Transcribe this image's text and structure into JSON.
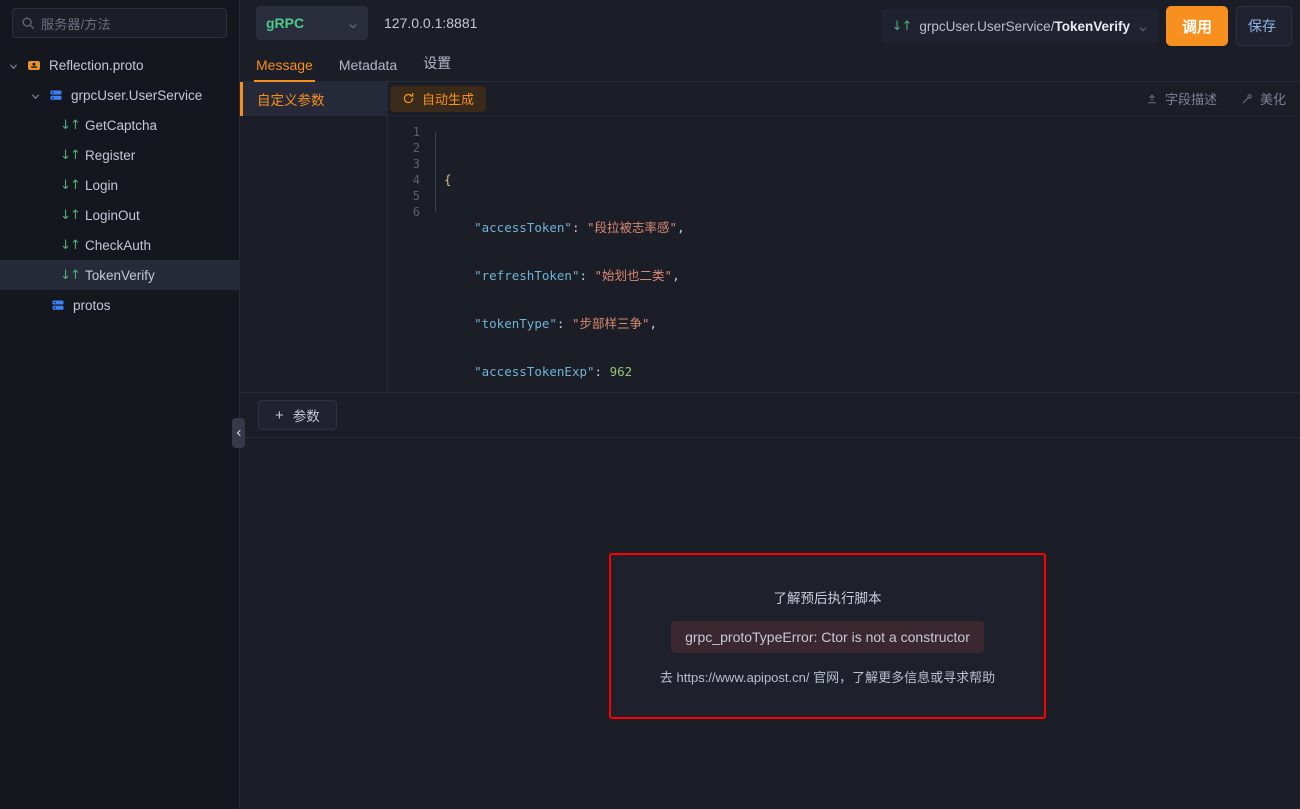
{
  "sidebar": {
    "search": {
      "placeholder": "服务器/方法",
      "icon": "search-icon"
    },
    "tree": [
      {
        "label": "Reflection.proto",
        "level": 0,
        "icon": "proto-file-icon",
        "caret": "chevron-down-icon",
        "selected": false
      },
      {
        "label": "grpcUser.UserService",
        "level": 1,
        "icon": "service-icon",
        "caret": "chevron-down-icon",
        "selected": false
      },
      {
        "label": "GetCaptcha",
        "level": 2,
        "icon": "method-icon",
        "caret": "",
        "selected": false
      },
      {
        "label": "Register",
        "level": 2,
        "icon": "method-icon",
        "caret": "",
        "selected": false
      },
      {
        "label": "Login",
        "level": 2,
        "icon": "method-icon",
        "caret": "",
        "selected": false
      },
      {
        "label": "LoginOut",
        "level": 2,
        "icon": "method-icon",
        "caret": "",
        "selected": false
      },
      {
        "label": "CheckAuth",
        "level": 2,
        "icon": "method-icon",
        "caret": "",
        "selected": false
      },
      {
        "label": "TokenVerify",
        "level": 2,
        "icon": "method-icon",
        "caret": "",
        "selected": true
      },
      {
        "label": "protos",
        "level": 1,
        "icon": "service-icon",
        "caret": "",
        "selected": false
      }
    ],
    "collapse_handle": "chevron-left-icon"
  },
  "topbar": {
    "protocol": "gRPC",
    "protocol_caret": "chevron-down-icon",
    "address": "127.0.0.1:8881",
    "method_icon": "method-icon",
    "method_prefix": "grpcUser.UserService/",
    "method_name": "TokenVerify",
    "method_caret": "chevron-down-icon",
    "call_button": "调用",
    "save_button": "保存"
  },
  "tabs": [
    {
      "label": "Message",
      "active": true
    },
    {
      "label": "Metadata",
      "active": false
    },
    {
      "label": "设置",
      "active": false
    }
  ],
  "params_panel": {
    "tab_label": "自定义参数",
    "add_button": "参数",
    "add_icon": "plus-icon"
  },
  "editor": {
    "generate_button": "自动生成",
    "generate_icon": "refresh-icon",
    "field_desc_button": "字段描述",
    "field_desc_icon": "upload-icon",
    "beautify_button": "美化",
    "beautify_icon": "wand-icon",
    "line_numbers": [
      "1",
      "2",
      "3",
      "4",
      "5",
      "6"
    ],
    "json": {
      "open_brace": "{",
      "close_brace": "}",
      "entries": [
        {
          "key": "\"accessToken\"",
          "colon": ": ",
          "value": "\"段拉被志率感\"",
          "type": "string",
          "comma": ","
        },
        {
          "key": "\"refreshToken\"",
          "colon": ": ",
          "value": "\"始划也二类\"",
          "type": "string",
          "comma": ","
        },
        {
          "key": "\"tokenType\"",
          "colon": ": ",
          "value": "\"步部样三争\"",
          "type": "string",
          "comma": ","
        },
        {
          "key": "\"accessTokenExp\"",
          "colon": ": ",
          "value": "962",
          "type": "number",
          "comma": ""
        }
      ]
    }
  },
  "error_panel": {
    "title": "了解预后执行脚本",
    "code": "grpc_protoTypeError: Ctor is not a constructor",
    "help": "去 https://www.apipost.cn/ 官网，了解更多信息或寻求帮助",
    "border_color": "#ff0000"
  },
  "colors": {
    "accent": "#f7901e",
    "protocol": "#4ec98b",
    "background": "#1b1d27",
    "sidebar_background": "#15171f",
    "error_border": "#ff0000"
  }
}
